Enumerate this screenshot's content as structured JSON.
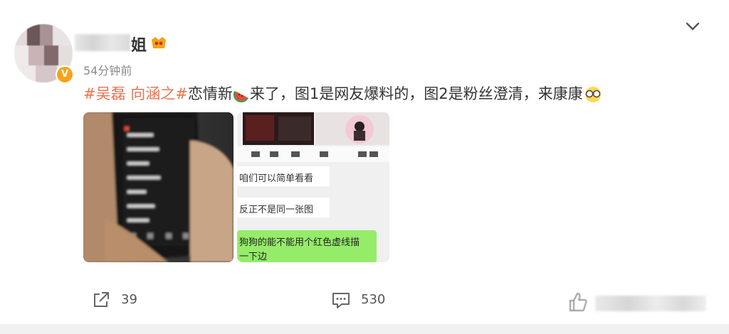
{
  "post": {
    "author_name_suffix": "姐",
    "time": "54分钟前",
    "hashtag": "#吴磊 向涵之#",
    "text_part1": "恋情新",
    "text_part2": "来了，图1是网友爆料的，图2是粉丝澄清，来康康"
  },
  "image2": {
    "msg1": "咱们可以简单看看",
    "msg2": "反正不是同一张图",
    "msg3_line1": "狗狗的能不能用个红色虚线描",
    "msg3_line2": "一下边"
  },
  "actions": {
    "share_count": "39",
    "comment_count": "530"
  },
  "colors": {
    "hashtag": "#eb7350",
    "badge": "#f7a21a",
    "chat_green": "#95ec69"
  },
  "icons": [
    "vip-badge-icon",
    "chevron-down-icon",
    "watermelon-emoji",
    "glasses-emoji",
    "share-icon",
    "comment-icon",
    "like-icon"
  ]
}
